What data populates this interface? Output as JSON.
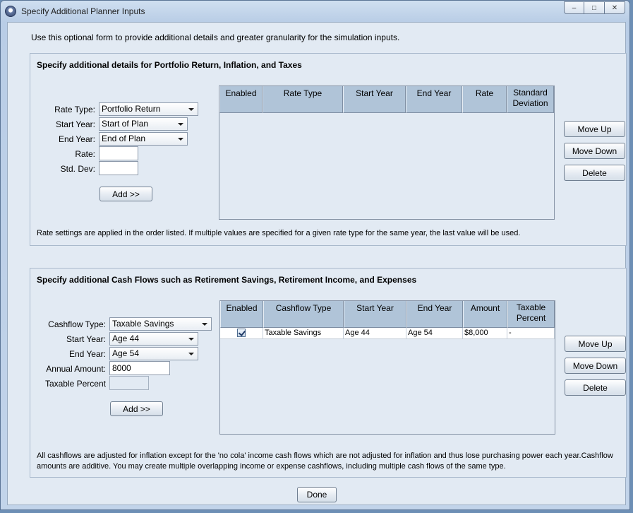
{
  "window": {
    "title": "Specify Additional Planner Inputs",
    "controls": {
      "minimize": "–",
      "maximize": "□",
      "close": "✕"
    }
  },
  "intro": "Use this optional form to provide additional details and greater granularity for the simulation inputs.",
  "rates": {
    "title": "Specify additional details for Portfolio Return, Inflation, and Taxes",
    "labels": {
      "rate_type": "Rate Type:",
      "start_year": "Start Year:",
      "end_year": "End Year:",
      "rate": "Rate:",
      "std_dev": "Std. Dev:"
    },
    "values": {
      "rate_type": "Portfolio Return",
      "start_year": "Start of Plan",
      "end_year": "End of Plan",
      "rate": "",
      "std_dev": ""
    },
    "add_button": "Add >>",
    "columns": [
      "Enabled",
      "Rate Type",
      "Start Year",
      "End Year",
      "Rate",
      "Standard Deviation"
    ],
    "rows": [],
    "buttons": {
      "move_up": "Move Up",
      "move_down": "Move Down",
      "delete": "Delete"
    },
    "note": "Rate settings are applied in the order listed.  If multiple values are specified for a given rate type for the same year, the last value will be used."
  },
  "cashflows": {
    "title": "Specify additional Cash Flows such as Retirement Savings, Retirement Income, and Expenses",
    "labels": {
      "cashflow_type": "Cashflow Type:",
      "start_year": "Start Year:",
      "end_year": "End Year:",
      "annual_amount": "Annual Amount:",
      "taxable_percent": "Taxable Percent"
    },
    "values": {
      "cashflow_type": "Taxable Savings",
      "start_year": "Age 44",
      "end_year": "Age 54",
      "annual_amount": "8000",
      "taxable_percent": ""
    },
    "add_button": "Add >>",
    "columns": [
      "Enabled",
      "Cashflow Type",
      "Start Year",
      "End Year",
      "Amount",
      "Taxable Percent"
    ],
    "rows": [
      {
        "enabled": true,
        "type": "Taxable Savings",
        "start": "Age 44",
        "end": "Age 54",
        "amount": "$8,000",
        "taxable": "-"
      }
    ],
    "buttons": {
      "move_up": "Move Up",
      "move_down": "Move Down",
      "delete": "Delete"
    },
    "note_line1": "All cashflows are adjusted for inflation except for the 'no cola' income cash flows which are not adjusted for inflation and thus lose purchasing power each year.Cashflow",
    "note_line2": "amounts are additive.  You may create multiple overlapping income or expense cashflows, including multiple cash flows of the same type."
  },
  "done_button": "Done"
}
